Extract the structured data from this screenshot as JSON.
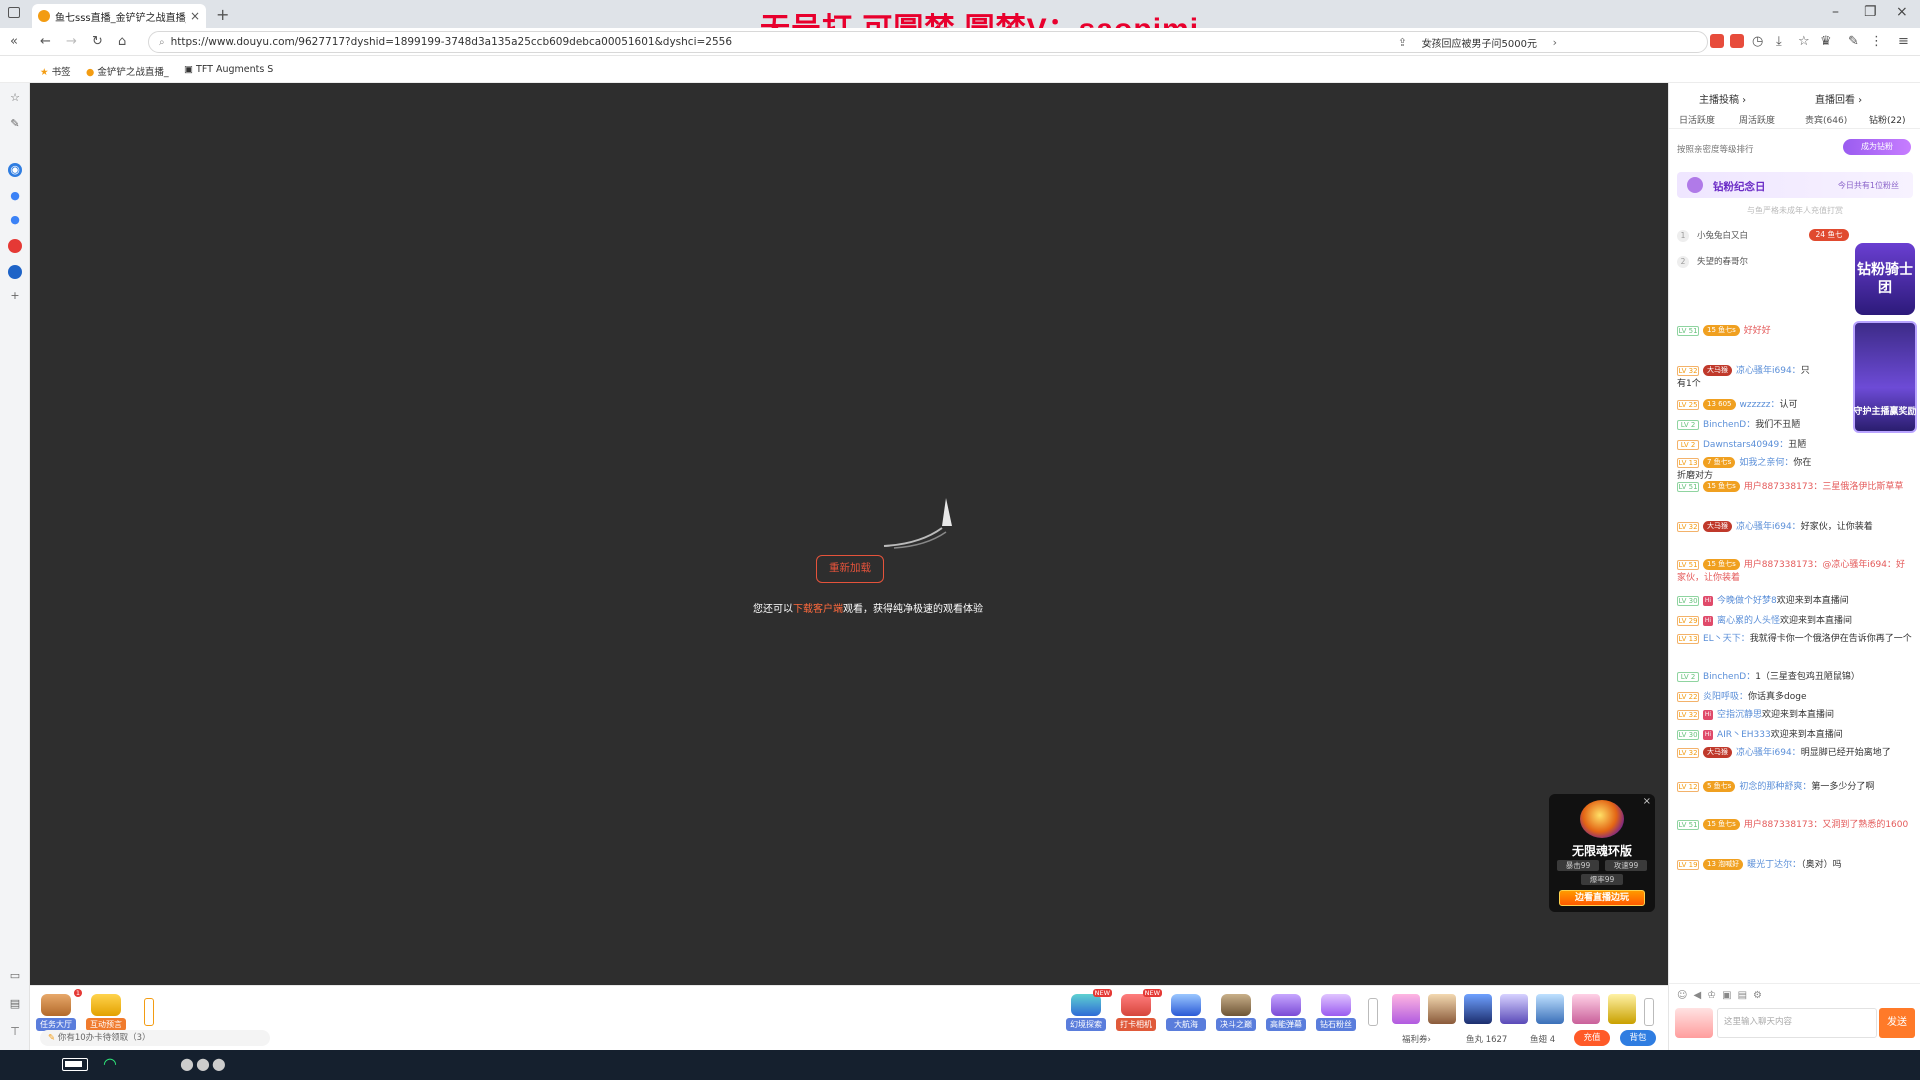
{
  "overlay_text": "无号打 可圆梦 圆梦V：saopimi",
  "browser": {
    "tab_title": "鱼七sss直播_金铲铲之战直播_斗",
    "url": "https://www.douyu.com/9627717?dyshid=1899199-3748d3a135a25ccb609debca00051601&dyshci=2556",
    "news_text": "女孩回应被男子问5000元",
    "bookmarks": [
      {
        "label": "书签"
      },
      {
        "label": "金铲铲之战直播_"
      },
      {
        "label": "TFT Augments S"
      }
    ]
  },
  "player": {
    "reload_label": "重新加载",
    "note_prefix": "您还可以",
    "note_link": "下载客户端",
    "note_suffix": "观看，获得纯净极速的观看体验"
  },
  "ad_card": {
    "name": "无限魂环版",
    "stat1": "暴击99",
    "stat2": "攻速99",
    "stat3": "爆率99",
    "cta": "边看直播边玩"
  },
  "bottom_bar": {
    "left_buttons": [
      {
        "label": "任务大厅",
        "badge": "1"
      },
      {
        "label": "互动预言"
      }
    ],
    "right_buttons": [
      {
        "label": "幻境探索",
        "tag": "NEW"
      },
      {
        "label": "打卡相机",
        "tag": "NEW"
      },
      {
        "label": "大航海"
      },
      {
        "label": "决斗之巅"
      },
      {
        "label": "高能弹幕"
      },
      {
        "label": "钻石粉丝"
      }
    ],
    "task_note": "你有10办卡待领取（3）",
    "welfare": "福利券›",
    "fish_balls": "鱼丸 1627",
    "fish_wings": "鱼翅 4",
    "recharge": "充值",
    "backpack": "背包"
  },
  "right_panel": {
    "header_left": "主播投稿 ›",
    "header_right": "直播回看 ›",
    "tabs": [
      "日活跃度",
      "周活跃度",
      "贵宾(646)",
      "钻粉(22)"
    ],
    "rank_hint": "按照亲密度等级排行",
    "become_btn": "成为钻粉",
    "memorial_title": "钻粉纪念日",
    "memorial_sub": "今日共有1位粉丝",
    "memorial_hint": "与鱼严格未成年人充值打赏",
    "rank_rows": [
      {
        "num": "1",
        "name": "小兔兔白又白",
        "badge": "24 鱼七"
      },
      {
        "num": "2",
        "name": "失望的春哥尔"
      }
    ],
    "knight_title": "钻粉骑士团",
    "knight_caption": "守护主播赢奖励",
    "chat": [
      {
        "lv": "LV 51",
        "fan": "15 鱼七s",
        "user": "",
        "text": "好好好"
      },
      {
        "lv": "LV 32",
        "fan": "大马猴",
        "user": "凉心骚年i694：",
        "text": "只有1个"
      },
      {
        "lv": "LV 25",
        "fan": "13 605",
        "user": "wzzzzz：",
        "text": "认可"
      },
      {
        "lv": "LV 2",
        "fan": "",
        "user": "BinchenD：",
        "text": "我们不丑陋"
      },
      {
        "lv": "LV 2",
        "fan": "",
        "user": "Dawnstars40949：",
        "text": "丑陋"
      },
      {
        "lv": "LV 13",
        "fan": "7 鱼七s",
        "user": "如我之亲何：",
        "text": "你在折磨对方"
      },
      {
        "lv": "LV 51",
        "fan": "15 鱼七s",
        "user": "用户887338173：",
        "text": "三星俄洛伊比斯草草"
      },
      {
        "lv": "LV 32",
        "fan": "大马猴",
        "user": "凉心骚年i694：",
        "text": "好家伙，让你装着"
      },
      {
        "lv": "LV 51",
        "fan": "15 鱼七s",
        "user": "用户887338173：",
        "text": "@凉心骚年i694：好家伙，让你装着"
      },
      {
        "lv": "LV 30",
        "fan": "Hi",
        "user": "今晚做个好梦8",
        "text": "欢迎来到本直播间"
      },
      {
        "lv": "LV 29",
        "fan": "Hi",
        "user": "离心累的人头怪",
        "text": "欢迎来到本直播间"
      },
      {
        "lv": "LV 13",
        "fan": "",
        "user": "EL丶天下：",
        "text": "我就得卡你一个俄洛伊在告诉你再了一个"
      },
      {
        "lv": "LV 2",
        "fan": "",
        "user": "BinchenD：",
        "text": "1（三星查包鸡丑陋鼠锦）"
      },
      {
        "lv": "LV 22",
        "fan": "",
        "user": "炎阳呼吸：",
        "text": "你话真多doge"
      },
      {
        "lv": "LV 32",
        "fan": "Hi",
        "user": "空指沉静思",
        "text": "欢迎来到本直播间"
      },
      {
        "lv": "LV 30",
        "fan": "Hi",
        "user": "AIR丶EH333",
        "text": "欢迎来到本直播间"
      },
      {
        "lv": "LV 32",
        "fan": "大马猴",
        "user": "凉心骚年i694：",
        "text": "明显脚已经开始离地了"
      },
      {
        "lv": "LV 12",
        "fan": "5 鱼七s",
        "user": "初念的那种舒爽：",
        "text": "第一多少分了啊"
      },
      {
        "lv": "LV 51",
        "fan": "15 鱼七s",
        "user": "用户887338173：",
        "text": "又洞到了熟悉的1600"
      },
      {
        "lv": "LV 19",
        "fan": "13 泡喊好",
        "user": "暖光丁达尔：",
        "text": "（奥对）吗"
      }
    ],
    "input_placeholder": "这里输入聊天内容",
    "send": "发送"
  },
  "colors": {
    "overlay_red": "#e8002d",
    "douyu_orange": "#ff7a29",
    "player_bg": "#2e2e2e"
  }
}
